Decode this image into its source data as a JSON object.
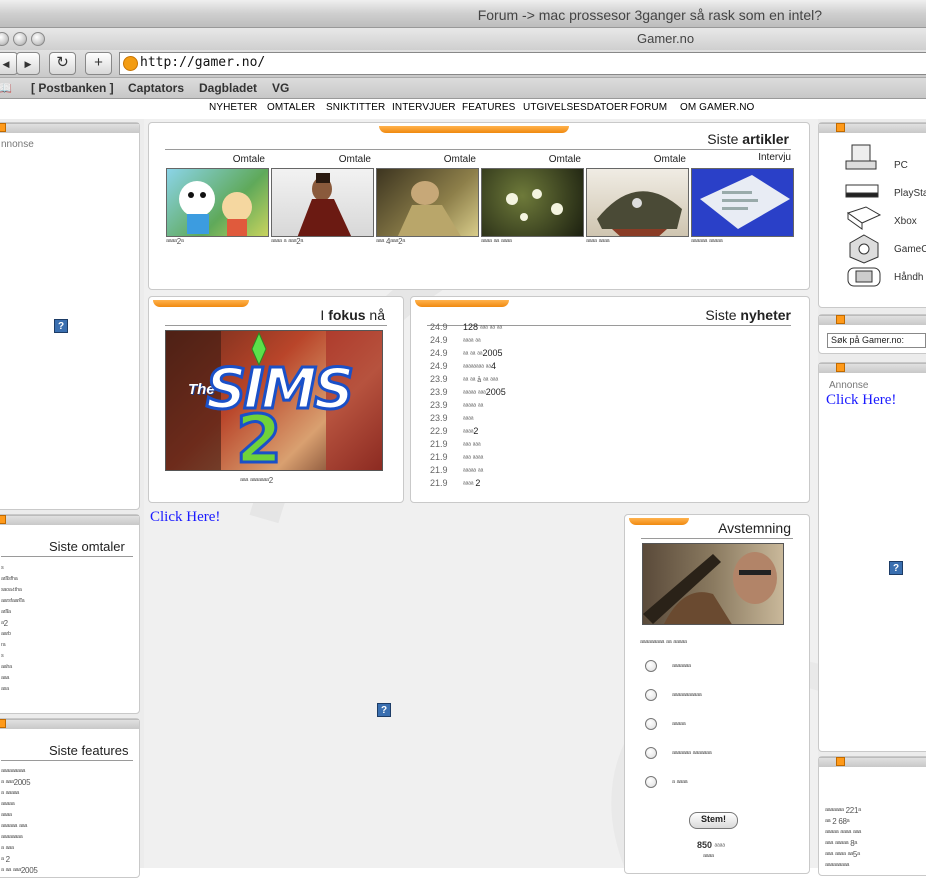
{
  "window": {
    "title_back": "Forum -> mac prossesor 3ganger så rask som en intel?",
    "title_front": "Gamer.no"
  },
  "toolbar": {
    "back_glyph": "◀",
    "forward_glyph": "▶",
    "reload_glyph": "↻",
    "add_glyph": "+",
    "url": "http://gamer.no/"
  },
  "bookmarks": [
    "📖",
    "[ Postbanken ]",
    "Captators",
    "Dagbladet",
    "VG"
  ],
  "nav": [
    "NYHETER",
    "OMTALER",
    "SNIKTITTER",
    "INTERVJUER",
    "FEATURES",
    "UTGIVELSESDATOER",
    "FORUM",
    "OM GAMER.NO"
  ],
  "left": {
    "annonse_label": "nnonse",
    "siste_omtaler": "Siste omtaler",
    "siste_features": "Siste features"
  },
  "articles": {
    "heading_pre": "Siste ",
    "heading_bold": "artikler",
    "items": [
      {
        "type": "Omtale"
      },
      {
        "type": "Omtale"
      },
      {
        "type": "Omtale"
      },
      {
        "type": "Omtale"
      },
      {
        "type": "Omtale"
      },
      {
        "type": "Intervju"
      }
    ]
  },
  "focus": {
    "heading_pre": "I ",
    "heading_bold": "fokus",
    "heading_post": " nå",
    "logo_the": "The",
    "logo_sims": "SIMS",
    "logo_2": "2"
  },
  "news": {
    "heading_pre": "Siste ",
    "heading_bold": "nyheter",
    "items": [
      {
        "date": "24.9",
        "title": "128"
      },
      {
        "date": "24.9",
        "title": ""
      },
      {
        "date": "24.9",
        "title": "2005"
      },
      {
        "date": "24.9",
        "title": "4"
      },
      {
        "date": "23.9",
        "title": ""
      },
      {
        "date": "23.9",
        "title": "2005"
      },
      {
        "date": "23.9",
        "title": ""
      },
      {
        "date": "23.9",
        "title": ""
      },
      {
        "date": "22.9",
        "title": "2"
      },
      {
        "date": "21.9",
        "title": ""
      },
      {
        "date": "21.9",
        "title": ""
      },
      {
        "date": "21.9",
        "title": ""
      },
      {
        "date": "21.9",
        "title": "2"
      }
    ]
  },
  "ad": {
    "click_here": "Click Here!"
  },
  "poll": {
    "heading": "Avstemning",
    "options_count": 5,
    "vote_label": "Stem!",
    "votes": "850"
  },
  "right": {
    "platforms": [
      "PC",
      "PlaySta",
      "Xbox",
      "GameC",
      "Håndh"
    ],
    "search_label": "Søk på Gamer.no:",
    "annonse_label": "Annonse",
    "click_here": "Click Here!"
  },
  "colors": {
    "accent": "#f39c12",
    "link": "#1a1aff"
  }
}
